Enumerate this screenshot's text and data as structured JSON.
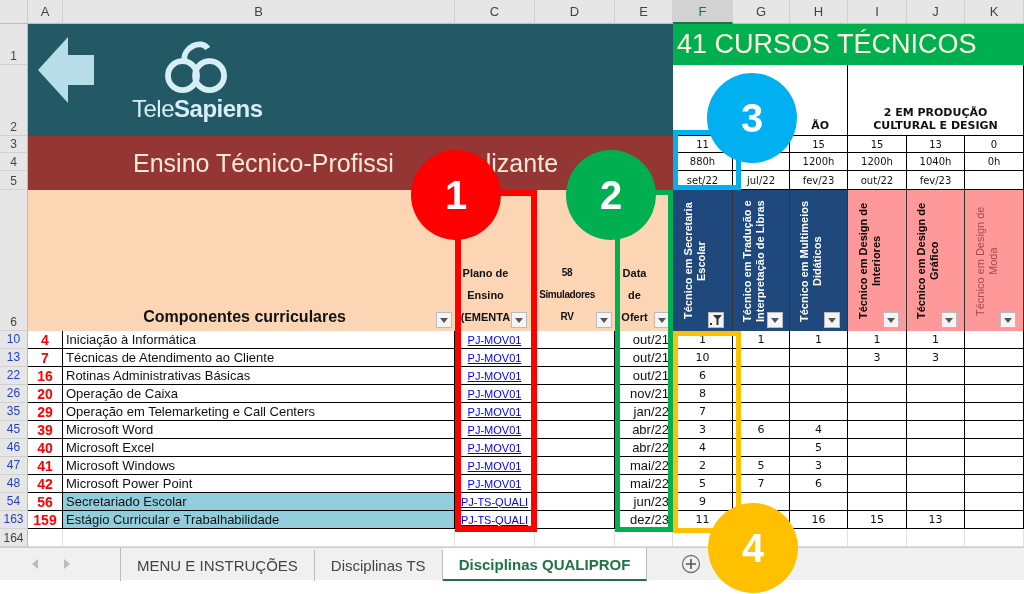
{
  "column_headers": [
    {
      "label": "A",
      "selected": false
    },
    {
      "label": "B",
      "selected": false
    },
    {
      "label": "C",
      "selected": false
    },
    {
      "label": "D",
      "selected": false
    },
    {
      "label": "E",
      "selected": false
    },
    {
      "label": "F",
      "selected": true
    },
    {
      "label": "G",
      "selected": false
    },
    {
      "label": "H",
      "selected": false
    },
    {
      "label": "I",
      "selected": false
    },
    {
      "label": "J",
      "selected": false
    },
    {
      "label": "K",
      "selected": false
    }
  ],
  "header_rows": [
    "1",
    "2",
    "3",
    "4",
    "5",
    "6"
  ],
  "banner": {
    "logo_text": "Tele**Sapiens**",
    "title_parts": [
      "Ensino Técnico-Profissi",
      "lizante"
    ]
  },
  "courses_title": "41 CURSOS TÉCNICOS",
  "groups": [
    "ÃO",
    "2 EM PRODUÇÃO\nCULTURAL E DESIGN"
  ],
  "header_labels": [
    {
      "label": "Componentes curriculares",
      "filtered": false
    },
    {
      "label": "Plano de\nEnsino\n(EMENTA",
      "filtered": false
    },
    {
      "label": "58\nSimuladores\nRV",
      "filtered": false
    },
    {
      "label": "Data de\nOfert",
      "filtered": false
    }
  ],
  "courses": [
    {
      "name": "Técnico em Secretaria Escolar",
      "count": "11",
      "hours": "880h",
      "date": "set/22",
      "color": "#1f497d",
      "faded": false,
      "filtered": true
    },
    {
      "name": "Técnico em Tradução e Interpretação de Libras",
      "date": "jul/22",
      "color": "#1f497d",
      "faded": false,
      "filtered": false
    },
    {
      "name": "Técnico em Multimeios Didáticos",
      "count": "15",
      "hours": "1200h",
      "date": "fev/23",
      "color": "#1f497d",
      "faded": false,
      "filtered": false
    },
    {
      "name": "Técnico em Design de Interiores",
      "count": "15",
      "hours": "1200h",
      "date": "out/22",
      "color": "#ff9999",
      "faded": false,
      "filtered": false
    },
    {
      "name": "Técnico em Design de Gráfico",
      "count": "13",
      "hours": "1040h",
      "date": "fev/23",
      "color": "#ff9999",
      "faded": false,
      "filtered": false
    },
    {
      "name": "Técnico em Design de Moda",
      "count": "0",
      "hours": "0h",
      "color": "#ff9999",
      "faded": true,
      "filtered": false
    }
  ],
  "rows": [
    {
      "row": "10",
      "num": "4",
      "name": "Iniciação à Informática",
      "plan": "PJ-MOV01",
      "date": "out/21",
      "highlight": false,
      "cells": [
        "1",
        "1",
        "1",
        "1",
        "1",
        null
      ]
    },
    {
      "row": "13",
      "num": "7",
      "name": "Técnicas de Atendimento ao Cliente",
      "plan": "PJ-MOV01",
      "date": "out/21",
      "highlight": false,
      "cells": [
        "10",
        null,
        null,
        "3",
        "3",
        null
      ]
    },
    {
      "row": "22",
      "num": "16",
      "name": "Rotinas Administrativas Básicas",
      "plan": "PJ-MOV01",
      "date": "out/21",
      "highlight": false,
      "cells": [
        "6",
        null,
        null,
        null,
        null,
        null
      ]
    },
    {
      "row": "26",
      "num": "20",
      "name": "Operação de Caixa",
      "plan": "PJ-MOV01",
      "date": "nov/21",
      "highlight": false,
      "cells": [
        "8",
        null,
        null,
        null,
        null,
        null
      ]
    },
    {
      "row": "35",
      "num": "29",
      "name": "Operação em Telemarketing e Call Centers",
      "plan": "PJ-MOV01",
      "date": "jan/22",
      "highlight": false,
      "cells": [
        "7",
        null,
        null,
        null,
        null,
        null
      ]
    },
    {
      "row": "45",
      "num": "39",
      "name": "Microsoft Word",
      "plan": "PJ-MOV01",
      "date": "abr/22",
      "highlight": false,
      "cells": [
        "3",
        "6",
        "4",
        null,
        null,
        null
      ]
    },
    {
      "row": "46",
      "num": "40",
      "name": "Microsoft Excel",
      "plan": "PJ-MOV01",
      "date": "abr/22",
      "highlight": false,
      "cells": [
        "4",
        null,
        "5",
        null,
        null,
        null
      ]
    },
    {
      "row": "47",
      "num": "41",
      "name": "Microsoft Windows",
      "plan": "PJ-MOV01",
      "date": "mai/22",
      "highlight": false,
      "cells": [
        "2",
        "5",
        "3",
        null,
        null,
        null
      ]
    },
    {
      "row": "48",
      "num": "42",
      "name": "Microsoft Power Point",
      "plan": "PJ-MOV01",
      "date": "mai/22",
      "highlight": false,
      "cells": [
        "5",
        "7",
        "6",
        null,
        null,
        null
      ]
    },
    {
      "row": "54",
      "num": "56",
      "name": "Secretariado Escolar",
      "plan": "PJ-TS-QUALI",
      "date": "jun/23",
      "highlight": true,
      "cells": [
        "9",
        null,
        null,
        null,
        null,
        null
      ]
    },
    {
      "row": "163",
      "num": "159",
      "name": "Estágio Curricular e Trabalhabilidade",
      "plan": "PJ-TS-QUALI",
      "date": "dez/23",
      "highlight": true,
      "cells": [
        "11",
        null,
        "16",
        "15",
        "13",
        null
      ]
    }
  ],
  "empty_row": "164",
  "tabs": [
    {
      "label": "MENU E INSTRUÇÕES",
      "selected": false
    },
    {
      "label": "Disciplinas TS",
      "selected": false
    },
    {
      "label": "Disciplinas QUALIPROF",
      "selected": true
    }
  ],
  "annotations": [
    {
      "label": "1",
      "color": "#ff0000"
    },
    {
      "label": "2",
      "color": "#00b050"
    },
    {
      "label": "3",
      "color": "#00b0f0"
    },
    {
      "label": "4",
      "color": "#ffc000"
    }
  ]
}
